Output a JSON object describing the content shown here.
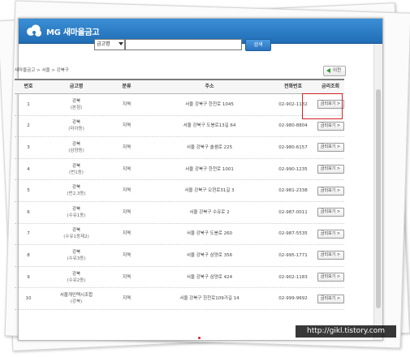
{
  "brand": {
    "name": "MG 새마을금고"
  },
  "search": {
    "select_value": "금고명",
    "input_value": "",
    "button_label": "검색"
  },
  "breadcrumb": {
    "text": "새마을금고 > 서울 > 강북구"
  },
  "prev_button": {
    "label": "이전"
  },
  "table": {
    "headers": [
      "번호",
      "금고명",
      "분류",
      "주소",
      "전화번호",
      "금리조회"
    ],
    "rows": [
      {
        "no": "1",
        "name": "강북",
        "sub": "(본점)",
        "type": "지역",
        "address": "서울 강북구 한천로 1045",
        "phone": "02-902-1182",
        "button": "금리보기 >"
      },
      {
        "no": "2",
        "name": "강북",
        "sub": "(미아동)",
        "type": "지역",
        "address": "서울 강북구 도봉로13길 64",
        "phone": "02-980-8804",
        "button": "금리보기 >"
      },
      {
        "no": "3",
        "name": "강북",
        "sub": "(삼양동)",
        "type": "지역",
        "address": "서울 강북구 솔샘로 225",
        "phone": "02-980-6157",
        "button": "금리보기 >"
      },
      {
        "no": "4",
        "name": "강북",
        "sub": "(번1동)",
        "type": "지역",
        "address": "서울 강북구 한천로 1001",
        "phone": "02-990-1235",
        "button": "금리보기 >"
      },
      {
        "no": "5",
        "name": "강북",
        "sub": "(번2,3동)",
        "type": "지역",
        "address": "서울 강북구 오현로31길 3",
        "phone": "02-981-2338",
        "button": "금리보기 >"
      },
      {
        "no": "6",
        "name": "강북",
        "sub": "(수유1동)",
        "type": "지역",
        "address": "서울 강북구 수유로 2",
        "phone": "02-987-0011",
        "button": "금리보기 >"
      },
      {
        "no": "7",
        "name": "강북",
        "sub": "(수유1동제2)",
        "type": "지역",
        "address": "서울 강북구 도봉로 260",
        "phone": "02-987-5535",
        "button": "금리보기 >"
      },
      {
        "no": "8",
        "name": "강북",
        "sub": "(수유3동)",
        "type": "지역",
        "address": "서울 강북구 삼양로 356",
        "phone": "02-995-1771",
        "button": "금리보기 >"
      },
      {
        "no": "9",
        "name": "강북",
        "sub": "(수유2동)",
        "type": "지역",
        "address": "서울 강북구 삼양로 424",
        "phone": "02-902-1183",
        "button": "금리보기 >"
      },
      {
        "no": "10",
        "name": "서울개인택시조합",
        "sub": "(강북)",
        "type": "지역",
        "address": "서울 강북구 한천로109가길 14",
        "phone": "02-999-9692",
        "button": "금리보기 >"
      }
    ]
  },
  "watermark": {
    "text": "http://gikl.tistory.com"
  },
  "colors": {
    "header": "#2a7cc7",
    "highlight": "#d0232a",
    "search_button": "#2a72c0"
  }
}
